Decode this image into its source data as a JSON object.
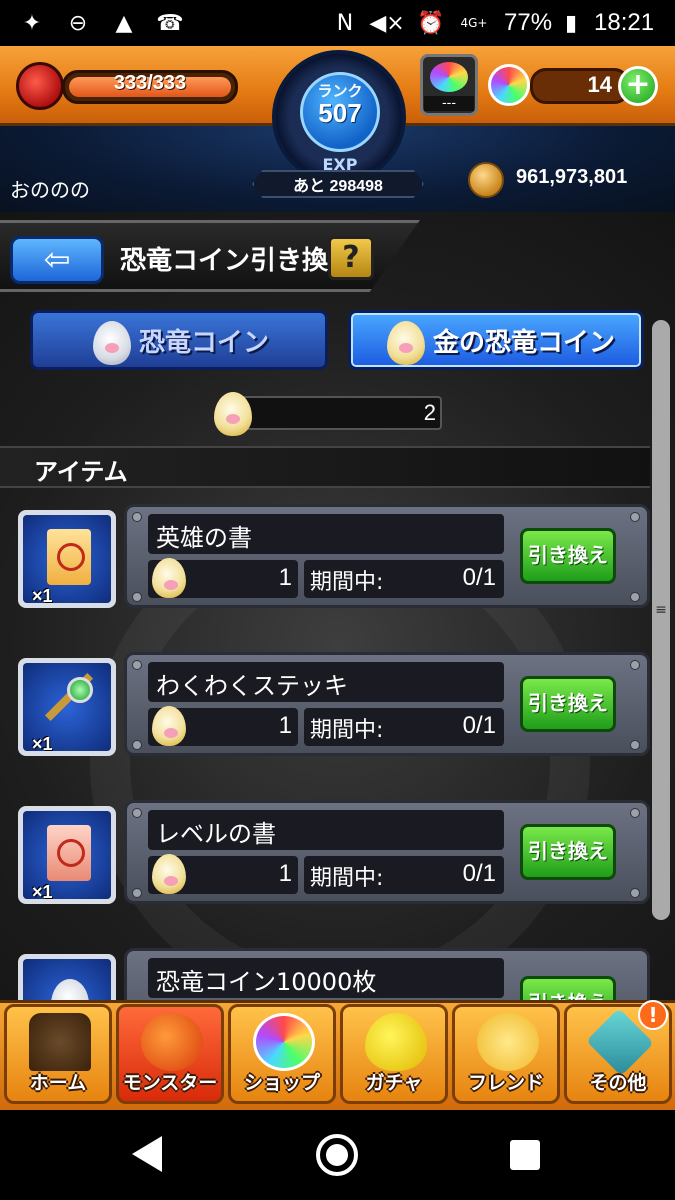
{
  "status_bar": {
    "battery_pct": "77%",
    "time": "18:21",
    "network": "4G+"
  },
  "header": {
    "stamina": "333/333",
    "rank_label": "ランク",
    "rank": "507",
    "exp_label": "EXP",
    "exp_remaining": "あと 298498",
    "pal_text": "---",
    "orb_count": "14",
    "orb_plus": "+",
    "username": "おののの",
    "coins": "961,973,801"
  },
  "page": {
    "title": "恐竜コイン引き換え",
    "help": "?"
  },
  "tabs": [
    {
      "label": "恐竜コイン",
      "active": false
    },
    {
      "label": "金の恐竜コイン",
      "active": true
    }
  ],
  "gold_coin_count": "2",
  "section_title": "アイテム",
  "items": [
    {
      "name": "英雄の書",
      "qty": "×1",
      "cost": "1",
      "period_label": "期間中:",
      "period_value": "0/1",
      "button": "引き換え",
      "icon": "scroll-icon"
    },
    {
      "name": "わくわくステッキ",
      "qty": "×1",
      "cost": "1",
      "period_label": "期間中:",
      "period_value": "0/1",
      "button": "引き換え",
      "icon": "wand-icon"
    },
    {
      "name": "レベルの書",
      "qty": "×1",
      "cost": "1",
      "period_label": "期間中:",
      "period_value": "0/1",
      "button": "引き換え",
      "icon": "scroll-red-icon"
    },
    {
      "name": "恐竜コイン10000枚",
      "qty": "",
      "cost": "",
      "period_label": "",
      "period_value": "",
      "button": "引き換え",
      "icon": "coin-icon"
    }
  ],
  "bottom_nav": [
    {
      "label": "ホーム",
      "icon": "home-icon"
    },
    {
      "label": "モンスター",
      "icon": "monster-icon"
    },
    {
      "label": "ショップ",
      "icon": "shop-orb-icon"
    },
    {
      "label": "ガチャ",
      "icon": "gacha-egg-icon"
    },
    {
      "label": "フレンド",
      "icon": "friend-icon"
    },
    {
      "label": "その他",
      "icon": "other-icon"
    }
  ],
  "notice_badge": "!",
  "colors": {
    "header_orange": "#e47a12",
    "tab_blue": "#1c5ae0",
    "exchange_green": "#1f9e1a",
    "panel_gray": "#5a5f6c"
  }
}
